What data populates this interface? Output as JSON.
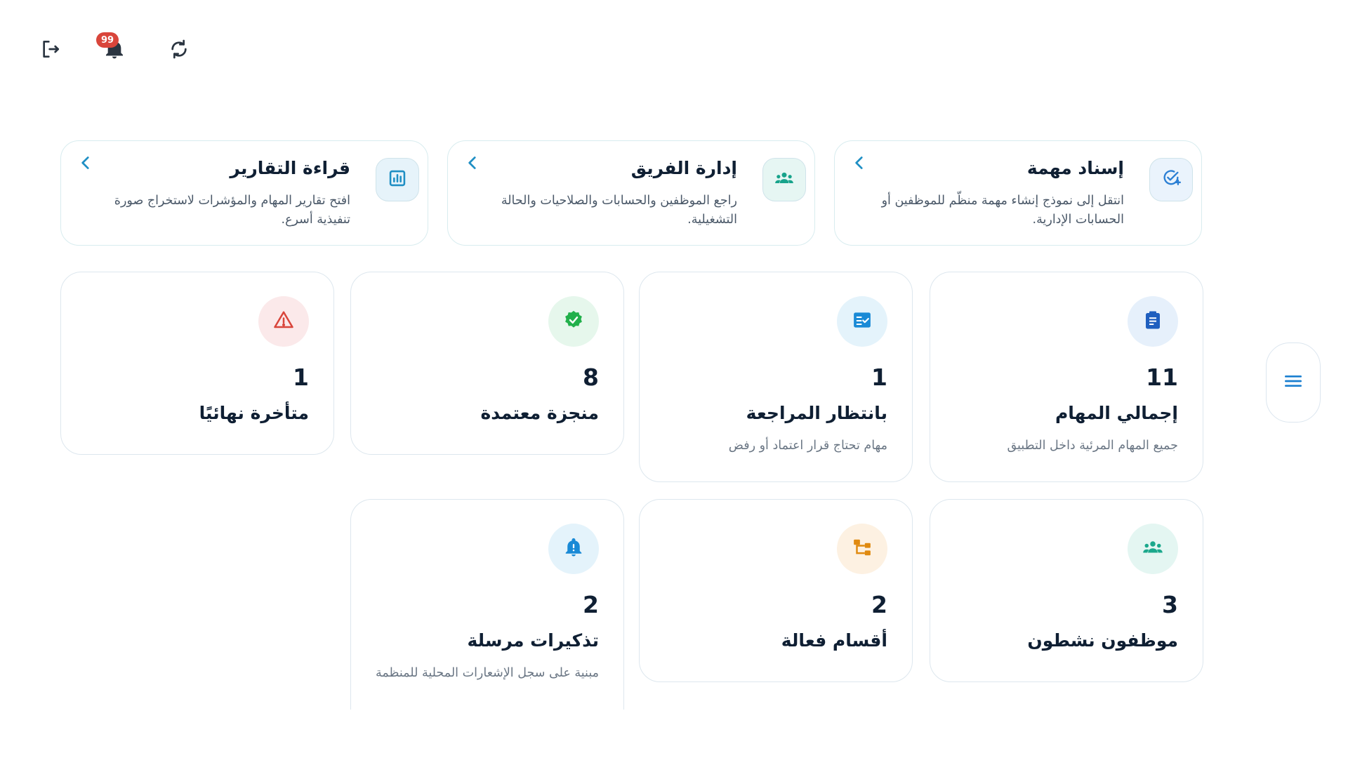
{
  "header": {
    "notification_count": "99",
    "icons": [
      "logout-icon",
      "bell-icon",
      "refresh-icon"
    ]
  },
  "actions": [
    {
      "title": "إسناد مهمة",
      "description": "انتقل إلى نموذج إنشاء مهمة منظّم للموظفين أو الحسابات الإدارية.",
      "icon": "task-add-icon",
      "accent": "#2b7fd4"
    },
    {
      "title": "إدارة الفريق",
      "description": "راجع الموظفين والحسابات والصلاحيات والحالة التشغيلية.",
      "icon": "team-icon",
      "accent": "#17a38b"
    },
    {
      "title": "قراءة التقارير",
      "description": "افتح تقارير المهام والمؤشرات لاستخراج صورة تنفيذية أسرع.",
      "icon": "report-chart-icon",
      "accent": "#1f8fc4"
    }
  ],
  "stats": [
    {
      "value": "11",
      "label": "إجمالي المهام",
      "sub": "جميع المهام المرئية داخل التطبيق",
      "icon": "clipboard-icon",
      "color": "#1f5fbf",
      "bg": "#e6f0fb"
    },
    {
      "value": "1",
      "label": "بانتظار المراجعة",
      "sub": "مهام تحتاج قرار اعتماد أو رفض",
      "icon": "checklist-icon",
      "color": "#1a8ad6",
      "bg": "#e4f3fb"
    },
    {
      "value": "8",
      "label": "منجزة معتمدة",
      "sub": "",
      "icon": "verified-badge-icon",
      "color": "#22b04b",
      "bg": "#e6f7ec"
    },
    {
      "value": "1",
      "label": "متأخرة نهائيًا",
      "sub": "",
      "icon": "warning-icon",
      "color": "#d9453b",
      "bg": "#fbe9ea"
    },
    {
      "value": "3",
      "label": "موظفون نشطون",
      "sub": "",
      "icon": "team-icon",
      "color": "#1ba88c",
      "bg": "#e4f6f2"
    },
    {
      "value": "2",
      "label": "أقسام فعالة",
      "sub": "",
      "icon": "department-tree-icon",
      "color": "#e08a10",
      "bg": "#fdf1e2"
    },
    {
      "value": "2",
      "label": "تذكيرات مرسلة",
      "sub": "مبنية على سجل الإشعارات المحلية للمنظمة",
      "icon": "alert-bell-icon",
      "color": "#1a8ad6",
      "bg": "#e4f3fb"
    }
  ],
  "menu": {
    "icon": "hamburger-menu-icon",
    "color": "#1a7fd0"
  }
}
